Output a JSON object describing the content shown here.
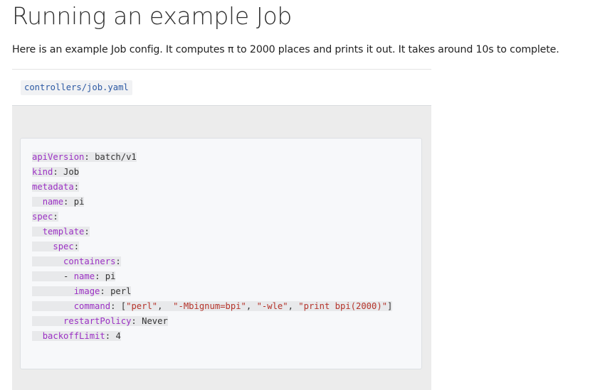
{
  "heading": "Running an example Job",
  "intro": "Here is an example Job config. It computes π to 2000 places and prints it out. It takes around 10s to complete.",
  "file": {
    "name": "controllers/job.yaml"
  },
  "code": {
    "lines": [
      {
        "indent": "",
        "key": "apiVersion",
        "sep": ": ",
        "value": "batch/v1"
      },
      {
        "indent": "",
        "key": "kind",
        "sep": ": ",
        "value": "Job"
      },
      {
        "indent": "",
        "key": "metadata",
        "sep": ":",
        "value": ""
      },
      {
        "indent": "  ",
        "key": "name",
        "sep": ": ",
        "value": "pi"
      },
      {
        "indent": "",
        "key": "spec",
        "sep": ":",
        "value": ""
      },
      {
        "indent": "  ",
        "key": "template",
        "sep": ":",
        "value": ""
      },
      {
        "indent": "    ",
        "key": "spec",
        "sep": ":",
        "value": ""
      },
      {
        "indent": "      ",
        "key": "containers",
        "sep": ":",
        "value": ""
      },
      {
        "indent": "      ",
        "dash": "- ",
        "key": "name",
        "sep": ": ",
        "value": "pi"
      },
      {
        "indent": "        ",
        "key": "image",
        "sep": ": ",
        "value": "perl"
      },
      {
        "indent": "        ",
        "key": "command",
        "sep": ": ",
        "command": [
          "\"perl\"",
          "\"-Mbignum=bpi\"",
          "\"-wle\"",
          "\"print bpi(2000)\""
        ]
      },
      {
        "indent": "      ",
        "key": "restartPolicy",
        "sep": ": ",
        "value": "Never"
      },
      {
        "indent": "  ",
        "key": "backoffLimit",
        "sep": ": ",
        "value": "4",
        "numeric": true
      }
    ]
  },
  "colors": {
    "key": "#9b30c4",
    "string": "#b5332a",
    "filename": "#2c59a3",
    "code_background": "#f7f8fa",
    "section_background": "#ececec"
  }
}
